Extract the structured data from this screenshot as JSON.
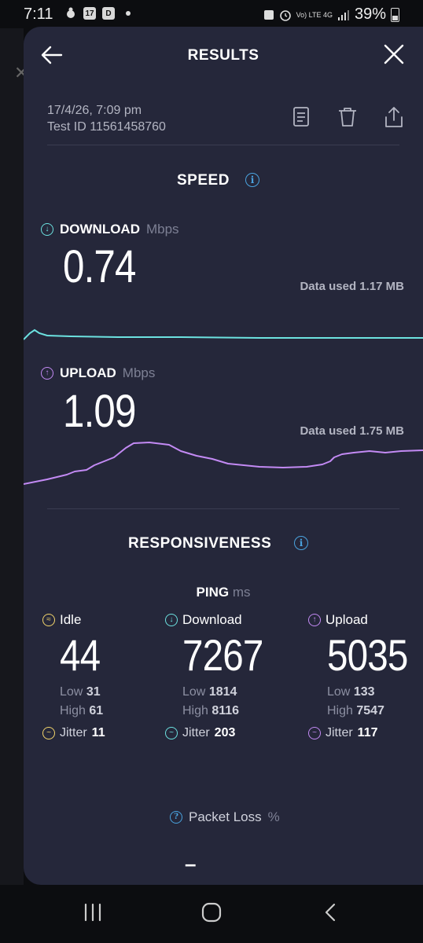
{
  "status_bar": {
    "time": "7:11",
    "mini_icons": [
      "17",
      "D"
    ],
    "net": "Vo) LTE 4G",
    "battery": "39%"
  },
  "header": {
    "title": "RESULTS"
  },
  "meta": {
    "datetime": "17/4/26, 7:09 pm",
    "test_id": "Test ID 11561458760"
  },
  "speed": {
    "title": "SPEED",
    "download": {
      "label": "DOWNLOAD",
      "unit": "Mbps",
      "value": "0.74",
      "data_used": "Data used 1.17 MB"
    },
    "upload": {
      "label": "UPLOAD",
      "unit": "Mbps",
      "value": "1.09",
      "data_used": "Data used 1.75 MB"
    }
  },
  "responsiveness": {
    "title": "RESPONSIVENESS",
    "ping_label": "PING",
    "ping_unit": "ms",
    "columns": [
      {
        "label": "Idle",
        "value": "44",
        "low_label": "Low",
        "low": "31",
        "high_label": "High",
        "high": "61",
        "jitter_label": "Jitter",
        "jitter": "11"
      },
      {
        "label": "Download",
        "value": "7267",
        "low_label": "Low",
        "low": "1814",
        "high_label": "High",
        "high": "8116",
        "jitter_label": "Jitter",
        "jitter": "203"
      },
      {
        "label": "Upload",
        "value": "5035",
        "low_label": "Low",
        "low": "133",
        "high_label": "High",
        "high": "7547",
        "jitter_label": "Jitter",
        "jitter": "117"
      }
    ]
  },
  "packet_loss": {
    "label": "Packet Loss",
    "unit": "%",
    "value": "–"
  },
  "colors": {
    "card": "#25273a",
    "download": "#6ce2e0",
    "upload": "#c38af4",
    "idle": "#f2d46b",
    "info": "#4aa3df"
  }
}
